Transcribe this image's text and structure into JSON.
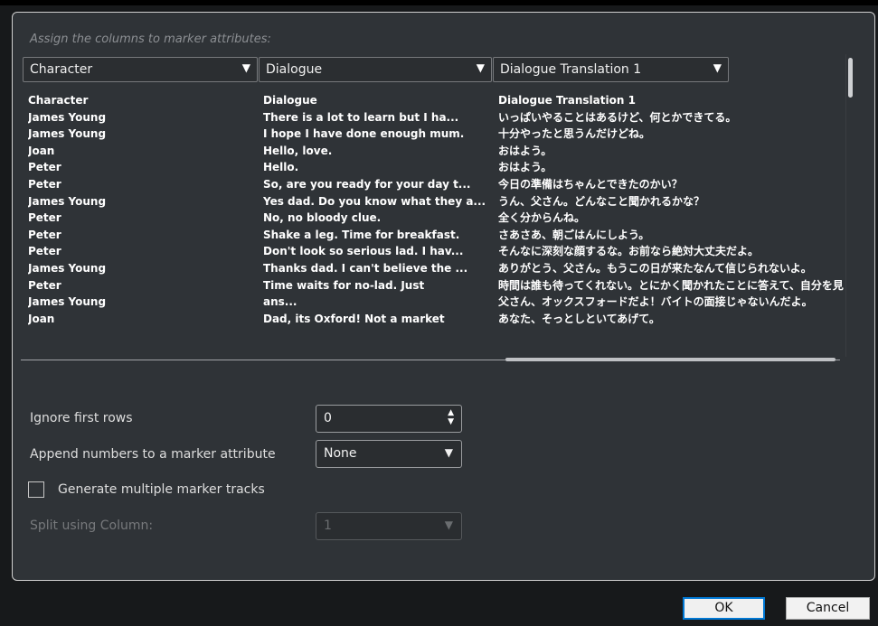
{
  "caption": "Assign the columns to marker attributes:",
  "column_selects": [
    "Character",
    "Dialogue",
    "Dialogue Translation 1"
  ],
  "preview": {
    "col1": [
      "Character",
      "James Young",
      "James Young",
      "Joan",
      "Peter",
      "Peter",
      "James Young",
      "Peter",
      "Peter",
      "Peter",
      "James Young",
      "Peter",
      "James Young",
      "Joan"
    ],
    "col2": [
      "Dialogue",
      "There is a lot to learn but I ha...",
      "I hope I have done enough mum.",
      "Hello, love.",
      "Hello.",
      "So, are you ready for your day t...",
      "Yes dad. Do you know what they a...",
      "No, no bloody clue.",
      "Shake a leg. Time for breakfast.",
      "Don't look so serious lad. I hav...",
      "Thanks dad. I can't believe the ...",
      "Time waits for no-lad. Just",
      "ans...",
      "Dad, its Oxford! Not a market"
    ],
    "col3": [
      "Dialogue Translation 1",
      "いっぱいやることはあるけど、何とかできてる。",
      "十分やったと思うんだけどね。",
      "おはよう。",
      "おはよう。",
      "今日の準備はちゃんとできたのかい？",
      "うん、父さん。どんなこと聞かれるかな？",
      "全く分からんね。",
      "さあさあ、朝ごはんにしよう。",
      "そんなに深刻な顔するな。お前なら絶対大丈夫だよ。",
      "ありがとう、父さん。もうこの日が来たなんて信じられないよ。",
      "時間は誰も待ってくれない。とにかく聞かれたことに答えて、自分を見",
      "父さん、オックスフォードだよ！バイトの面接じゃないんだよ。",
      "あなた、そっとしといてあげて。"
    ]
  },
  "options": {
    "ignore_rows_label": "Ignore first rows",
    "ignore_rows_value": "0",
    "append_label": "Append numbers to a marker attribute",
    "append_value": "None",
    "generate_label": "Generate multiple marker tracks",
    "split_label": "Split using Column:",
    "split_value": "1"
  },
  "buttons": {
    "ok": "OK",
    "cancel": "Cancel"
  },
  "icons": {
    "dropdown": "▼",
    "spin_up": "▲",
    "spin_down": "▼"
  }
}
